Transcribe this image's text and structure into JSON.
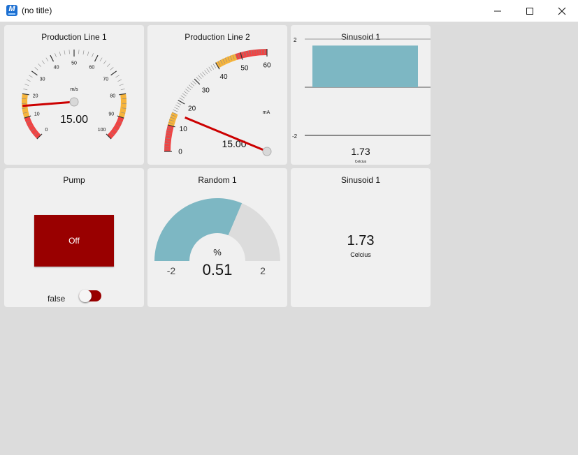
{
  "window": {
    "title": "(no title)",
    "app_icon_letter": "M"
  },
  "cards": {
    "prod1": {
      "title": "Production Line 1",
      "value": "15.00",
      "unit": "m/s",
      "min": 0,
      "max": 100,
      "ticks": [
        "0",
        "10",
        "20",
        "30",
        "40",
        "50",
        "60",
        "70",
        "80",
        "90",
        "100"
      ]
    },
    "prod2": {
      "title": "Production Line 2",
      "value": "15.00",
      "unit": "mA",
      "min": 0,
      "max": 60,
      "ticks": [
        "0",
        "10",
        "20",
        "30",
        "40",
        "50",
        "60"
      ]
    },
    "sin_chart": {
      "title": "Sinusoid 1",
      "value": "1.73",
      "unit": "Celcius",
      "ymax_label": "2",
      "ymin_label": "-2"
    },
    "pump": {
      "title": "Pump",
      "button_label": "Off",
      "switch_label": "false"
    },
    "random": {
      "title": "Random 1",
      "unit": "%",
      "value": "0.51",
      "min_label": "-2",
      "max_label": "2"
    },
    "sin_text": {
      "title": "Sinusoid 1",
      "value": "1.73",
      "unit": "Celcius"
    }
  },
  "colors": {
    "accent": "#7db7c3",
    "pump_red": "#990000",
    "needle": "#cc0000",
    "warn": "#f6b43c",
    "danger": "#ef4444"
  },
  "chart_data": {
    "type": "bar",
    "categories": [
      ""
    ],
    "values": [
      1.73
    ],
    "title": "Sinusoid 1",
    "xlabel": "",
    "ylabel": "Celcius",
    "ylim": [
      -2,
      2
    ]
  }
}
